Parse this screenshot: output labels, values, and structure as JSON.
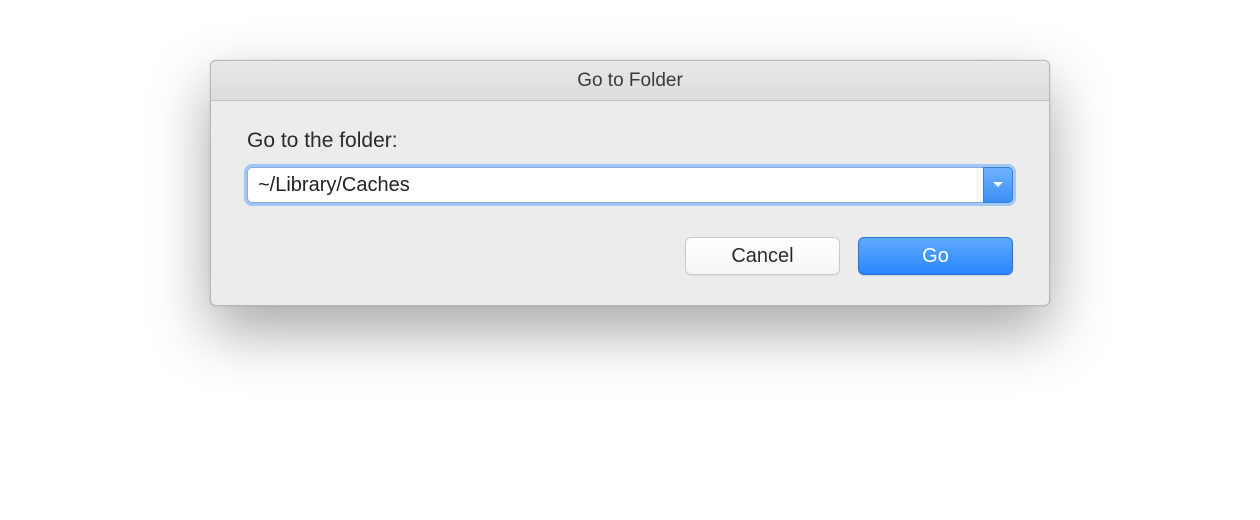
{
  "dialog": {
    "title": "Go to Folder",
    "label": "Go to the folder:",
    "path_value": "~/Library/Caches",
    "buttons": {
      "cancel_label": "Cancel",
      "go_label": "Go"
    }
  }
}
